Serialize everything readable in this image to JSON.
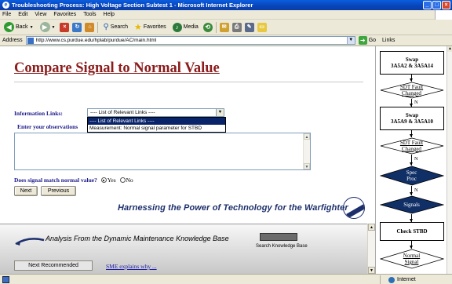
{
  "window": {
    "title": "Troubleshooting Process: High Voltage Section Subtest 1 - Microsoft Internet Explorer"
  },
  "menu": [
    "File",
    "Edit",
    "View",
    "Favorites",
    "Tools",
    "Help"
  ],
  "toolbar": {
    "back": "Back",
    "search": "Search",
    "favorites": "Favorites",
    "media": "Media"
  },
  "address": {
    "label": "Address",
    "url": "http://www.cs.purdue.edu/hplab/purdue/AC/main.html",
    "go": "Go",
    "links": "Links"
  },
  "page": {
    "heading": "Compare Signal to Normal Value",
    "info_label": "Information Links:",
    "select_value": "---- List of Relevant Links ----",
    "options": [
      "---- List of Relevant Links ----",
      "Measurement: Normal signal parameter for STBD"
    ],
    "observations_label": "Enter your observations",
    "match_question": "Does signal match normal value?",
    "yes": "Yes",
    "no": "No",
    "answer": "Yes",
    "next": "Next",
    "previous": "Previous",
    "tagline": "Harnessing the Power of Technology for the Warfighter"
  },
  "lower": {
    "title": "Analysis From the  Dynamic Maintenance Knowledge Base",
    "search_kb": "Search Knowledge Base",
    "next_recommended": "Next Recommended",
    "sme": "SME explains why ..."
  },
  "flowchart": {
    "box1": [
      "Swap",
      "3A5A2 & 3A5A14"
    ],
    "diamond1": [
      "SDT Fault",
      "Changed"
    ],
    "n": "N",
    "box2": [
      "Swap",
      "3A5A9 & 3A5A10"
    ],
    "diamond2": [
      "SDT Fault",
      "Changed"
    ],
    "diamond3": [
      "Spec",
      "Proc"
    ],
    "diamond4": [
      "Signals"
    ],
    "box3": [
      "Check STBD"
    ],
    "diamond5": [
      "Normal",
      "Signal"
    ],
    "dark_color": "#102f66"
  },
  "status": {
    "zone": "Internet"
  }
}
